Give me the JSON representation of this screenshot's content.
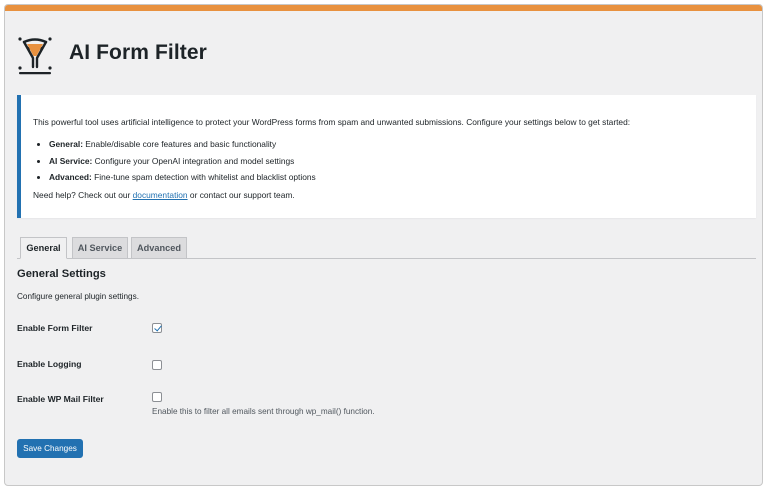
{
  "header": {
    "title": "AI Form Filter",
    "logo_icon": "funnel-icon"
  },
  "notice": {
    "intro": "This powerful tool uses artificial intelligence to protect your WordPress forms from spam and unwanted submissions. Configure your settings below to get started:",
    "items": [
      {
        "label": "General:",
        "text": " Enable/disable core features and basic functionality"
      },
      {
        "label": "AI Service:",
        "text": " Configure your OpenAI integration and model settings"
      },
      {
        "label": "Advanced:",
        "text": " Fine-tune spam detection with whitelist and blacklist options"
      }
    ],
    "help_prefix": "Need help? Check out our ",
    "help_link": "documentation",
    "help_suffix": " or contact our support team."
  },
  "tabs": [
    {
      "label": "General",
      "active": true
    },
    {
      "label": "AI Service",
      "active": false
    },
    {
      "label": "Advanced",
      "active": false
    }
  ],
  "section": {
    "title": "General Settings",
    "description": "Configure general plugin settings."
  },
  "fields": [
    {
      "label": "Enable Form Filter",
      "checked": true
    },
    {
      "label": "Enable Logging",
      "checked": false
    },
    {
      "label": "Enable WP Mail Filter",
      "checked": false,
      "description": "Enable this to filter all emails sent through wp_mail() function."
    }
  ],
  "save_label": "Save Changes",
  "colors": {
    "accent": "#2271b1",
    "top_bar": "#e8913f",
    "background": "#f0f0f1"
  }
}
